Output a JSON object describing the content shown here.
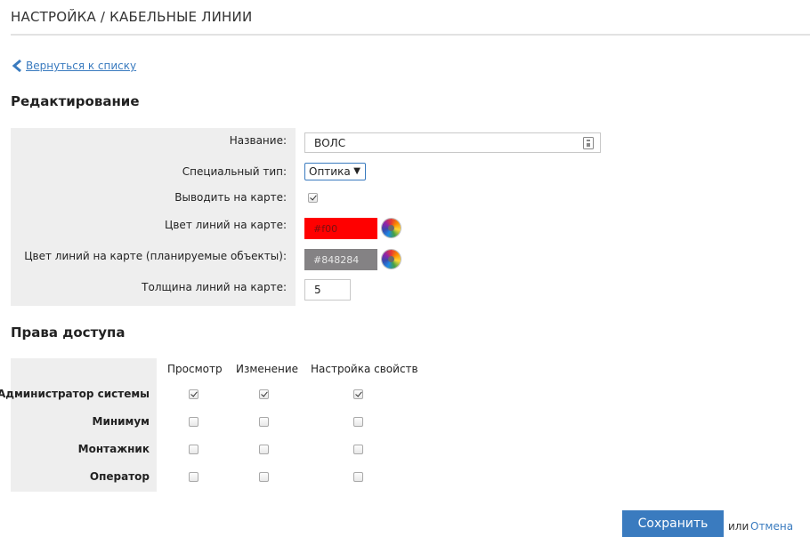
{
  "page": {
    "title": "НАСТРОЙКА / КАБЕЛЬНЫЕ ЛИНИИ"
  },
  "back_link": {
    "label": "Вернуться к списку",
    "icon": "chevron-left-icon"
  },
  "edit_section": {
    "title": "Редактирование",
    "fields": {
      "name": {
        "label": "Название:",
        "value": "ВОЛС",
        "icon": "field-list-icon"
      },
      "special_type": {
        "label": "Специальный тип:",
        "value": "Оптика"
      },
      "show_on_map": {
        "label": "Выводить на карте:",
        "checked": true
      },
      "line_color": {
        "label": "Цвет линий на карте:",
        "value": "#f00",
        "swatch": "#ff0000"
      },
      "planned_color": {
        "label": "Цвет линий на карте (планируемые объекты):",
        "value": "#848284",
        "swatch": "#848284"
      },
      "line_thickness": {
        "label": "Толщина линий на карте:",
        "value": "5"
      }
    }
  },
  "access_section": {
    "title": "Права доступа",
    "columns": [
      "Просмотр",
      "Изменение",
      "Настройка свойств"
    ],
    "roles": [
      {
        "name": "Администратор системы",
        "view": true,
        "edit": true,
        "configure": true
      },
      {
        "name": "Минимум",
        "view": false,
        "edit": false,
        "configure": false
      },
      {
        "name": "Монтажник",
        "view": false,
        "edit": false,
        "configure": false
      },
      {
        "name": "Оператор",
        "view": false,
        "edit": false,
        "configure": false
      }
    ]
  },
  "actions": {
    "save_label": "Сохранить",
    "or_text": "или",
    "cancel_label": "Отмена"
  },
  "colors": {
    "accent": "#3a7bbf",
    "panel": "#eeeeee"
  }
}
